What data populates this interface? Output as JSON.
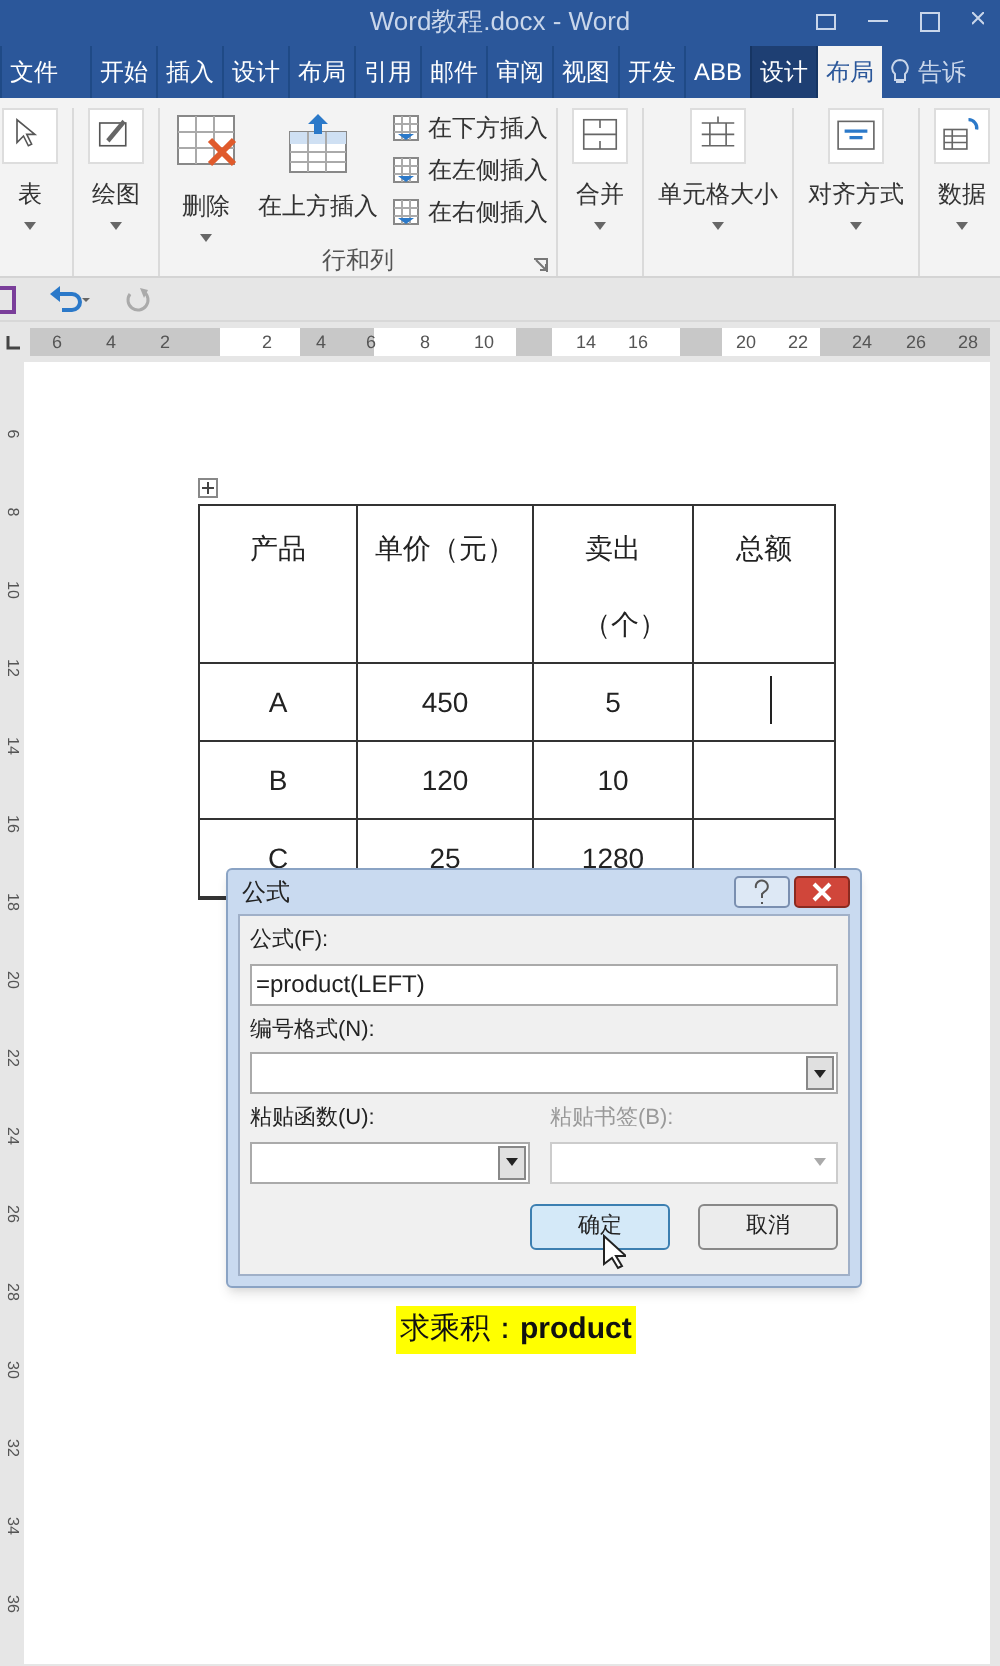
{
  "window": {
    "title": "Word教程.docx - Word"
  },
  "tabs": [
    {
      "label": "文件",
      "selected": false,
      "contextual": false
    },
    {
      "label": "开始",
      "selected": false,
      "contextual": false
    },
    {
      "label": "插入",
      "selected": false,
      "contextual": false
    },
    {
      "label": "设计",
      "selected": false,
      "contextual": false
    },
    {
      "label": "布局",
      "selected": false,
      "contextual": false
    },
    {
      "label": "引用",
      "selected": false,
      "contextual": false
    },
    {
      "label": "邮件",
      "selected": false,
      "contextual": false
    },
    {
      "label": "审阅",
      "selected": false,
      "contextual": false
    },
    {
      "label": "视图",
      "selected": false,
      "contextual": false
    },
    {
      "label": "开发",
      "selected": false,
      "contextual": false
    },
    {
      "label": "ABB",
      "selected": false,
      "contextual": false
    },
    {
      "label": "设计",
      "selected": false,
      "contextual": true
    },
    {
      "label": "布局",
      "selected": true,
      "contextual": true
    }
  ],
  "tell_me": "告诉",
  "ribbon": {
    "groups": [
      {
        "buttons": [
          {
            "label": "表",
            "kind": "select"
          }
        ]
      },
      {
        "buttons": [
          {
            "label": "绘图",
            "kind": "draw"
          }
        ]
      },
      {
        "label": "行和列",
        "buttons": [
          {
            "label": "删除",
            "kind": "delete"
          },
          {
            "label": "在上方插入",
            "kind": "insert-above"
          }
        ],
        "small_buttons": [
          "在下方插入",
          "在左侧插入",
          "在右侧插入"
        ]
      },
      {
        "buttons": [
          {
            "label": "合并",
            "kind": "merge"
          }
        ]
      },
      {
        "buttons": [
          {
            "label": "单元格大小",
            "kind": "size"
          }
        ]
      },
      {
        "buttons": [
          {
            "label": "对齐方式",
            "kind": "align"
          }
        ]
      },
      {
        "buttons": [
          {
            "label": "数据",
            "kind": "data"
          }
        ]
      }
    ]
  },
  "ruler": {
    "labels": [
      "6",
      "4",
      "2",
      "2",
      "4",
      "6",
      "8",
      "10",
      "14",
      "16",
      "20",
      "22",
      "24",
      "26",
      "28"
    ],
    "vertical_labels": [
      "6",
      "8",
      "10",
      "12",
      "14",
      "16",
      "18",
      "20",
      "22",
      "24",
      "26",
      "28",
      "30",
      "32",
      "34",
      "36"
    ]
  },
  "table": {
    "header": [
      "产品",
      "单价（元）",
      "卖出（个）",
      "总额"
    ],
    "rows": [
      [
        "A",
        "450",
        "5",
        ""
      ],
      [
        "B",
        "120",
        "10",
        ""
      ],
      [
        "C",
        "25",
        "1280",
        ""
      ]
    ]
  },
  "dialog": {
    "title": "公式",
    "formula_label": "公式(F):",
    "formula_value": "=product(LEFT)",
    "number_format_label": "编号格式(N):",
    "paste_function_label": "粘贴函数(U):",
    "paste_bookmark_label": "粘贴书签(B):",
    "paste_bookmark_disabled": true,
    "ok": "确定",
    "cancel": "取消"
  },
  "caption": "求乘积：**product**"
}
